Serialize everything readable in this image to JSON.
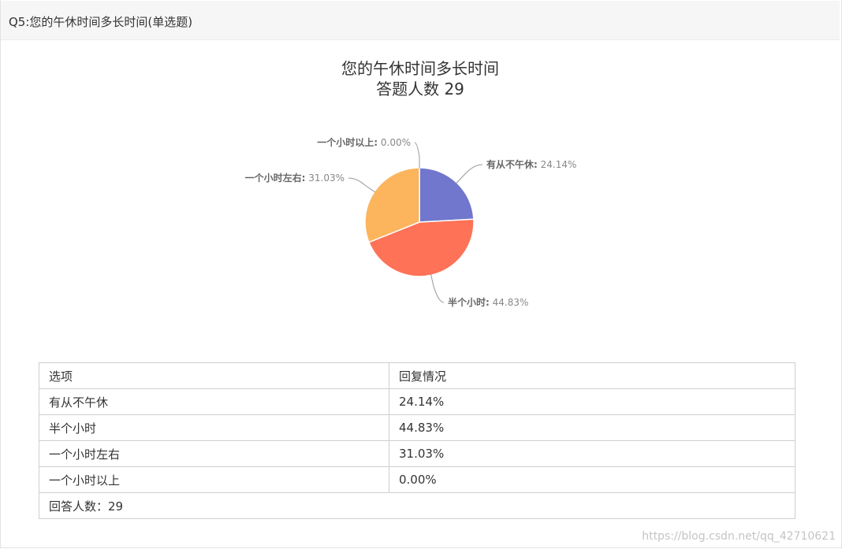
{
  "header": {
    "question": "Q5:您的午休时间多长时间(单选题)"
  },
  "chart_title": "您的午休时间多长时间",
  "chart_subtitle": "答题人数 29",
  "chart_data": {
    "type": "pie",
    "title": "您的午休时间多长时间",
    "subtitle": "答题人数 29",
    "categories": [
      "有从不午休",
      "半个小时",
      "一个小时左右",
      "一个小时以上"
    ],
    "values": [
      24.14,
      44.83,
      31.03,
      0.0
    ],
    "value_labels": [
      "24.14%",
      "44.83%",
      "31.03%",
      "0.00%"
    ],
    "colors": [
      "#7077cc",
      "#fe7257",
      "#fcb45d",
      "#7cb5ec"
    ]
  },
  "table": {
    "headers": [
      "选项",
      "回复情况"
    ],
    "rows": [
      [
        "有从不午休",
        "24.14%"
      ],
      [
        "半个小时",
        "44.83%"
      ],
      [
        "一个小时左右",
        "31.03%"
      ],
      [
        "一个小时以上",
        "0.00%"
      ]
    ],
    "footer": "回答人数：29"
  },
  "watermark": "https://blog.csdn.net/qq_42710621"
}
